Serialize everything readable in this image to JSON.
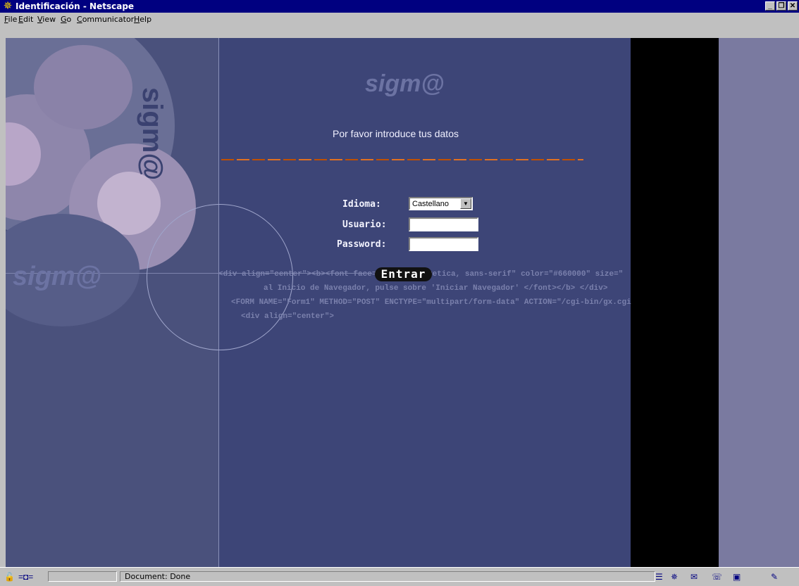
{
  "window": {
    "title": "Identificación - Netscape",
    "controls": [
      "_",
      "❐",
      "✕"
    ]
  },
  "menu": {
    "items": [
      "File",
      "Edit",
      "View",
      "Go",
      "Communicator",
      "Help"
    ]
  },
  "page": {
    "logo": "sigm@",
    "prompt": "Por favor introduce tus datos",
    "idioma_label": "Idioma:",
    "idioma_value": "Castellano",
    "usuario_label": "Usuario:",
    "password_label": "Password:",
    "submit_label": "Entrar",
    "code_lines": [
      "<div align=\"center\"><b><font face=\"Arial, Helvetica, sans-serif\" color=\"#660000\" size=\"",
      "al Inicio de Navegador, pulse sobre 'Iniciar Navegador' </font></b> </div>",
      "<FORM NAME=\"Form1\" METHOD=\"POST\" ENCTYPE=\"multipart/form-data\" ACTION=\"/cgi-bin/gx.cgi",
      "<div align=\"center\">"
    ]
  },
  "status": {
    "text": "Document: Done"
  },
  "colors": {
    "titlebar": "#000080",
    "content": "#3d4577",
    "accent": "#c05000"
  }
}
